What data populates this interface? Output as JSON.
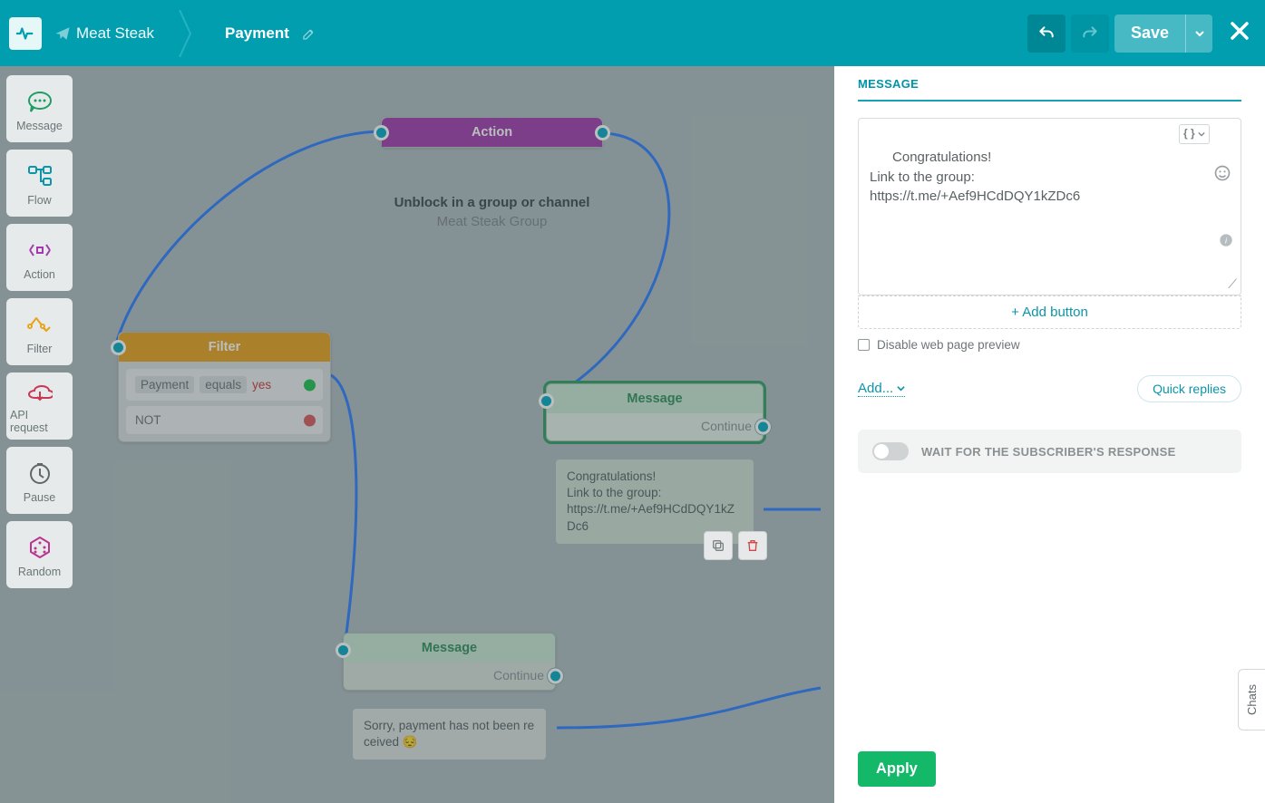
{
  "header": {
    "breadcrumb1": "Meat Steak",
    "breadcrumb2": "Payment",
    "save_label": "Save"
  },
  "sidebar": {
    "items": [
      {
        "label": "Message",
        "icon": "message"
      },
      {
        "label": "Flow",
        "icon": "flow"
      },
      {
        "label": "Action",
        "icon": "action"
      },
      {
        "label": "Filter",
        "icon": "filter"
      },
      {
        "label": "API request",
        "icon": "api"
      },
      {
        "label": "Pause",
        "icon": "pause"
      },
      {
        "label": "Random",
        "icon": "random"
      }
    ]
  },
  "nodes": {
    "action": {
      "title": "Action",
      "line1": "Unblock in a group or channel",
      "line2": "Meat Steak Group"
    },
    "filter": {
      "title": "Filter",
      "row1_field": "Payment",
      "row1_op": "equals",
      "row1_val": "yes",
      "row2": "NOT"
    },
    "message1": {
      "title": "Message",
      "text": "Congratulations!\nLink to the group:\nhttps://t.me/+Aef9HCdDQY1kZDc6",
      "continue": "Continue"
    },
    "message2": {
      "title": "Message",
      "text": "Sorry, payment has not been received 😔",
      "continue": "Continue"
    }
  },
  "panel": {
    "title": "MESSAGE",
    "editor_text": "Congratulations!\nLink to the group:\nhttps://t.me/+Aef9HCdDQY1kZDc6",
    "add_button": "+ Add button",
    "disable_preview": "Disable web page preview",
    "add_link": "Add...",
    "quick_replies": "Quick replies",
    "wait_label": "WAIT FOR THE SUBSCRIBER'S RESPONSE",
    "apply": "Apply"
  },
  "chats_tab": "Chats"
}
